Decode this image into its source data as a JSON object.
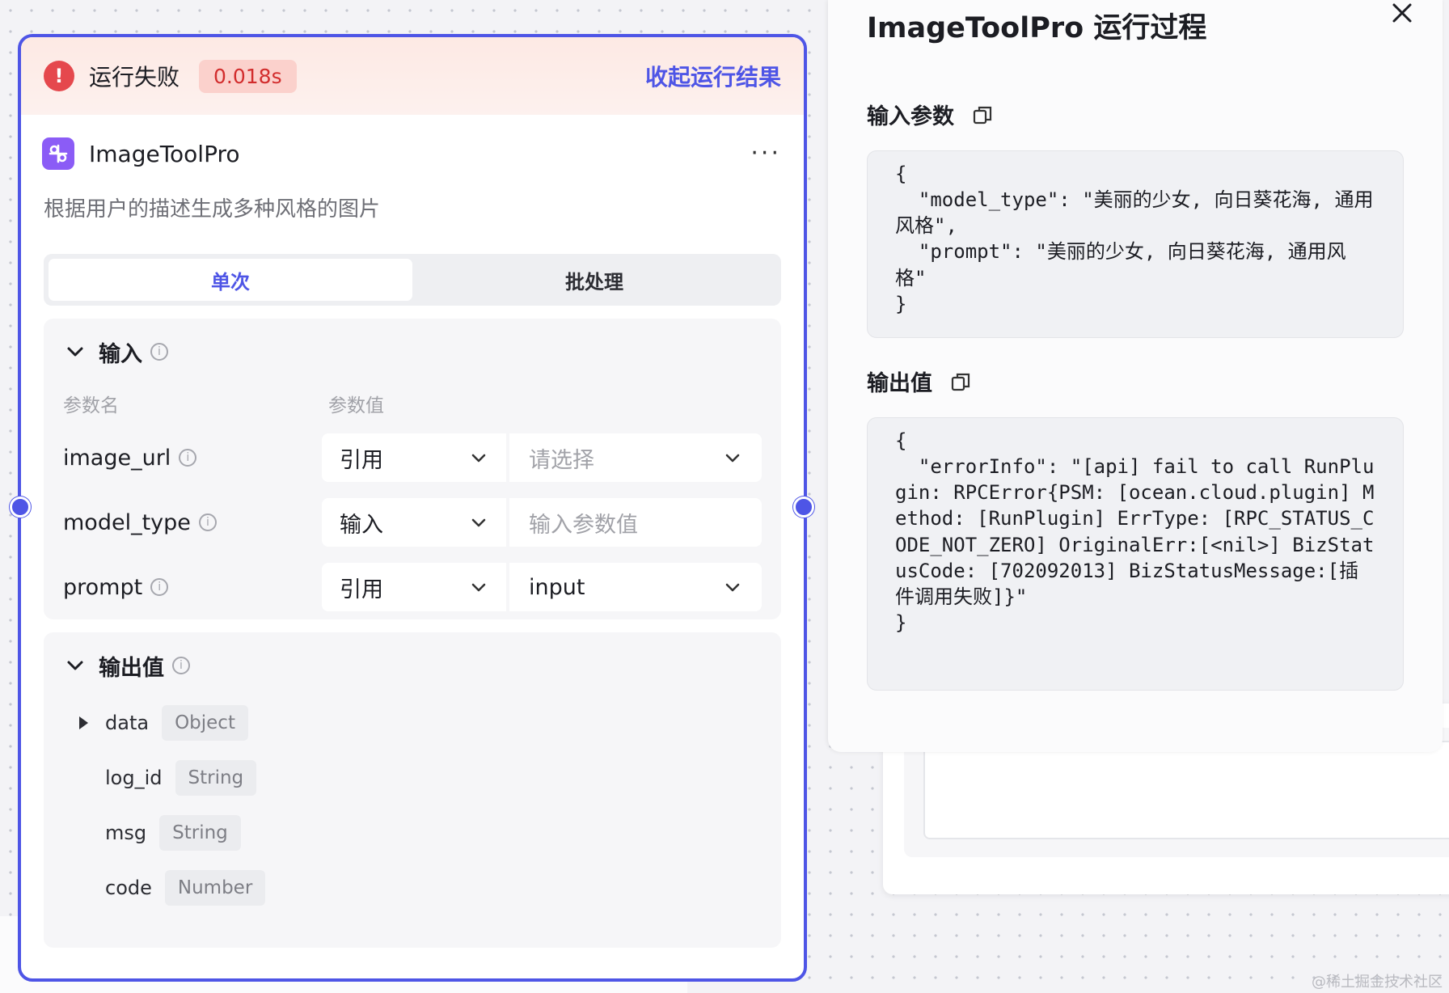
{
  "node": {
    "status_text": "运行失败",
    "duration": "0.018s",
    "collapse_label": "收起运行结果",
    "name": "ImageToolPro",
    "description": "根据用户的描述生成多种风格的图片",
    "tabs": [
      "单次",
      "批处理"
    ],
    "active_tab": "单次",
    "input_section": {
      "title": "输入",
      "col_name": "参数名",
      "col_value": "参数值",
      "params": [
        {
          "name": "image_url",
          "mode": "引用",
          "value": "请选择",
          "value_is_placeholder": true,
          "has_dropdown": true
        },
        {
          "name": "model_type",
          "mode": "输入",
          "value": "输入参数值",
          "value_is_placeholder": true,
          "has_dropdown": false
        },
        {
          "name": "prompt",
          "mode": "引用",
          "value": "input",
          "value_is_placeholder": false,
          "has_dropdown": true
        }
      ]
    },
    "output_section": {
      "title": "输出值",
      "fields": [
        {
          "name": "data",
          "type": "Object",
          "expandable": true
        },
        {
          "name": "log_id",
          "type": "String",
          "expandable": false
        },
        {
          "name": "msg",
          "type": "String",
          "expandable": false
        },
        {
          "name": "code",
          "type": "Number",
          "expandable": false
        }
      ]
    }
  },
  "panel": {
    "title": "ImageToolPro  运行过程",
    "input_label": "输入参数",
    "input_json": "{\n  \"model_type\": \"美丽的少女, 向日葵花海, 通用风格\",\n  \"prompt\": \"美丽的少女, 向日葵花海, 通用风格\"\n}",
    "output_label": "输出值",
    "output_json": "{\n  \"errorInfo\": \"[api] fail to call RunPlugin: RPCError{PSM: [ocean.cloud.plugin] Method: [RunPlugin] ErrType: [RPC_STATUS_CODE_NOT_ZERO] OriginalErr:[<nil>] BizStatusCode: [702092013] BizStatusMessage:[插件调用失败]}\"\n}"
  },
  "watermark": "@稀土掘金技术社区",
  "colors": {
    "accent": "#4e55e6",
    "error": "#e5484d",
    "plugin": "#8b5cf6"
  }
}
